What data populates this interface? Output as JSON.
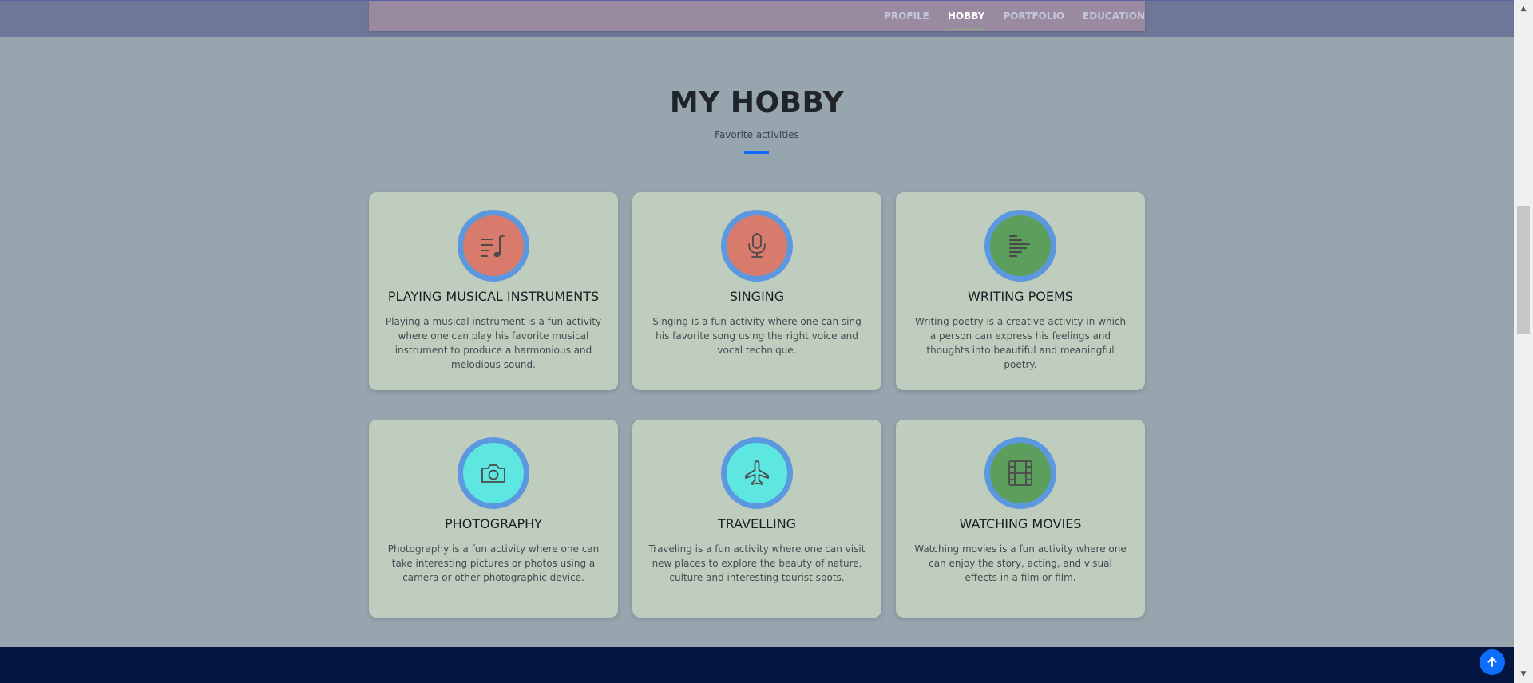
{
  "nav": {
    "links": [
      {
        "label": "PROFILE",
        "active": false
      },
      {
        "label": "HOBBY",
        "active": true
      },
      {
        "label": "PORTFOLIO",
        "active": false
      },
      {
        "label": "EDUCATION",
        "active": false
      }
    ]
  },
  "section": {
    "title": "MY HOBBY",
    "subtitle": "Favorite activities"
  },
  "hobbies": [
    {
      "title": "PLAYING MUSICAL INSTRUMENTS",
      "icon": "music-note-list-icon",
      "color": "#d97b6c",
      "description": "Playing a musical instrument is a fun activity where one can play his favorite musical instrument to produce a harmonious and melodious sound."
    },
    {
      "title": "SINGING",
      "icon": "microphone-icon",
      "color": "#d97b6c",
      "description": "Singing is a fun activity where one can sing his favorite song using the right voice and vocal technique."
    },
    {
      "title": "WRITING POEMS",
      "icon": "text-paragraph-icon",
      "color": "#5c9f5c",
      "description": "Writing poetry is a creative activity in which a person can express his feelings and thoughts into beautiful and meaningful poetry."
    },
    {
      "title": "PHOTOGRAPHY",
      "icon": "camera-icon",
      "color": "#5ee6e0",
      "description": "Photography is a fun activity where one can take interesting pictures or photos using a camera or other photographic device."
    },
    {
      "title": "TRAVELLING",
      "icon": "airplane-icon",
      "color": "#5ee6e0",
      "description": "Traveling is a fun activity where one can visit new places to explore the beauty of nature, culture and interesting tourist spots."
    },
    {
      "title": "WATCHING MOVIES",
      "icon": "film-icon",
      "color": "#5c9f5c",
      "description": "Watching movies is a fun activity where one can enjoy the story, acting, and visual effects in a film or film."
    }
  ],
  "colors": {
    "accent": "#0d6efd",
    "footer": "#031540",
    "icon_ring": "#5c98e0"
  }
}
